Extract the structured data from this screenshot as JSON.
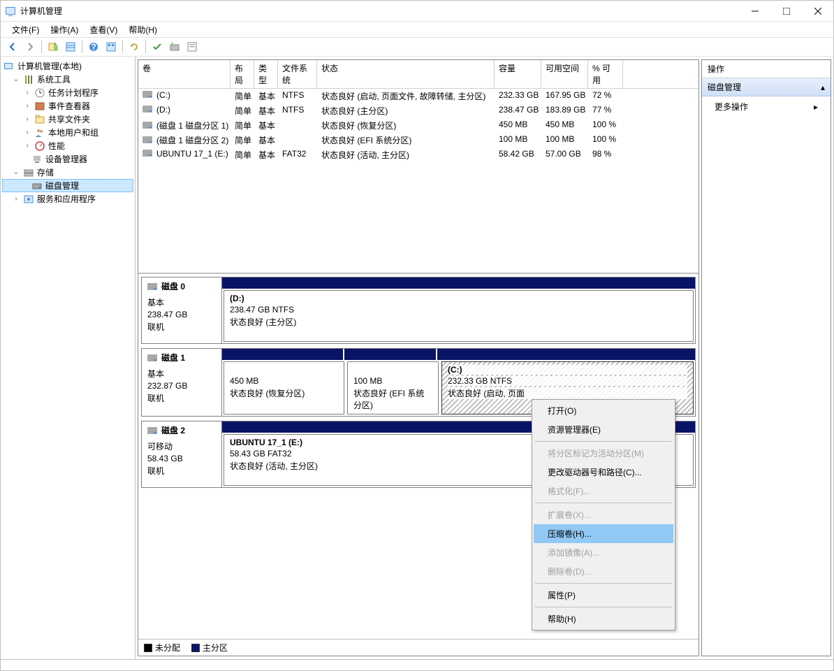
{
  "window": {
    "title": "计算机管理"
  },
  "menu": {
    "file": "文件(F)",
    "action": "操作(A)",
    "view": "查看(V)",
    "help": "帮助(H)"
  },
  "tree": {
    "root": "计算机管理(本地)",
    "systools": "系统工具",
    "task": "任务计划程序",
    "event": "事件查看器",
    "shared": "共享文件夹",
    "users": "本地用户和组",
    "perf": "性能",
    "devmgr": "设备管理器",
    "storage": "存储",
    "diskmgmt": "磁盘管理",
    "services": "服务和应用程序"
  },
  "vol_headers": {
    "volume": "卷",
    "layout": "布局",
    "type": "类型",
    "fs": "文件系统",
    "status": "状态",
    "capacity": "容量",
    "free": "可用空间",
    "pct": "% 可用"
  },
  "volumes": [
    {
      "name": "(C:)",
      "layout": "简单",
      "type": "基本",
      "fs": "NTFS",
      "status": "状态良好 (启动, 页面文件, 故障转储, 主分区)",
      "cap": "232.33 GB",
      "free": "167.95 GB",
      "pct": "72 %"
    },
    {
      "name": "(D:)",
      "layout": "简单",
      "type": "基本",
      "fs": "NTFS",
      "status": "状态良好 (主分区)",
      "cap": "238.47 GB",
      "free": "183.89 GB",
      "pct": "77 %"
    },
    {
      "name": "(磁盘 1 磁盘分区 1)",
      "layout": "简单",
      "type": "基本",
      "fs": "",
      "status": "状态良好 (恢复分区)",
      "cap": "450 MB",
      "free": "450 MB",
      "pct": "100 %"
    },
    {
      "name": "(磁盘 1 磁盘分区 2)",
      "layout": "简单",
      "type": "基本",
      "fs": "",
      "status": "状态良好 (EFI 系统分区)",
      "cap": "100 MB",
      "free": "100 MB",
      "pct": "100 %"
    },
    {
      "name": "UBUNTU 17_1 (E:)",
      "layout": "简单",
      "type": "基本",
      "fs": "FAT32",
      "status": "状态良好 (活动, 主分区)",
      "cap": "58.42 GB",
      "free": "57.00 GB",
      "pct": "98 %"
    }
  ],
  "disks": {
    "d0": {
      "name": "磁盘 0",
      "type": "基本",
      "size": "238.47 GB",
      "state": "联机",
      "p0": {
        "label": "(D:)",
        "size": "238.47 GB NTFS",
        "status": "状态良好 (主分区)"
      }
    },
    "d1": {
      "name": "磁盘 1",
      "type": "基本",
      "size": "232.87 GB",
      "state": "联机",
      "p0": {
        "label": "",
        "size": "450 MB",
        "status": "状态良好 (恢复分区)"
      },
      "p1": {
        "label": "",
        "size": "100 MB",
        "status": "状态良好 (EFI 系统分区)"
      },
      "p2": {
        "label": "(C:)",
        "size": "232.33 GB NTFS",
        "status": "状态良好 (启动, 页面"
      }
    },
    "d2": {
      "name": "磁盘 2",
      "type": "可移动",
      "size": "58.43 GB",
      "state": "联机",
      "p0": {
        "label": "UBUNTU 17_1  (E:)",
        "size": "58.43 GB FAT32",
        "status": "状态良好 (活动, 主分区)"
      }
    }
  },
  "legend": {
    "unalloc": "未分配",
    "primary": "主分区"
  },
  "actions_panel": {
    "header": "操作",
    "section": "磁盘管理",
    "more": "更多操作"
  },
  "context": {
    "open": "打开(O)",
    "explorer": "资源管理器(E)",
    "markactive": "将分区标记为活动分区(M)",
    "changedrive": "更改驱动器号和路径(C)...",
    "format": "格式化(F)...",
    "extend": "扩展卷(X)...",
    "shrink": "压缩卷(H)...",
    "mirror": "添加镜像(A)...",
    "delete": "删除卷(D)...",
    "props": "属性(P)",
    "help": "帮助(H)"
  }
}
